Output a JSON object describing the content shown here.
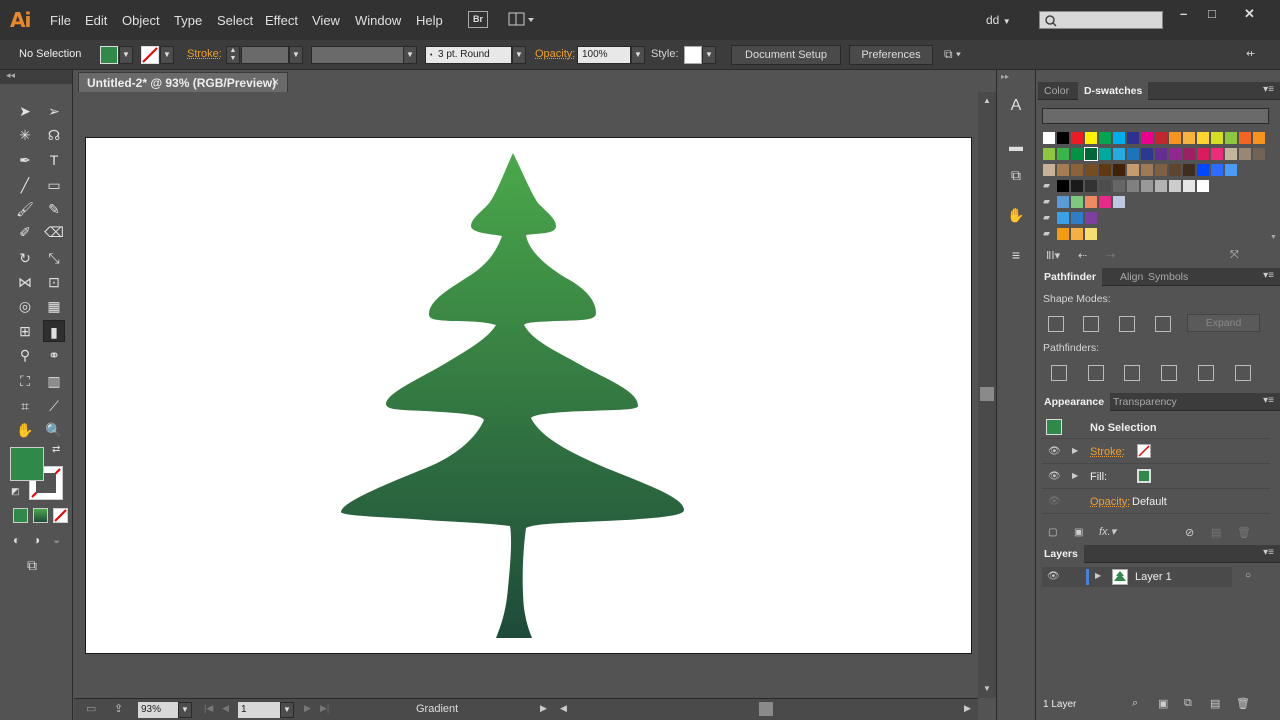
{
  "app": {
    "logo": "Ai"
  },
  "menu": [
    "File",
    "Edit",
    "Object",
    "Type",
    "Select",
    "Effect",
    "View",
    "Window",
    "Help"
  ],
  "bridge_label": "Br",
  "workspace_label": "dd",
  "window_controls": [
    "–",
    "□",
    "✕"
  ],
  "control": {
    "selection": "No Selection",
    "stroke_label": "Stroke:",
    "brush": "3 pt. Round",
    "opacity_label": "Opacity:",
    "opacity_value": "100%",
    "style_label": "Style:",
    "doc_setup": "Document Setup",
    "preferences": "Preferences"
  },
  "document": {
    "tab_title": "Untitled-2* @ 93% (RGB/Preview)",
    "zoom": "93%",
    "artboard_num": "1",
    "status_text": "Gradient"
  },
  "colors": {
    "tree_top": "#4aa84a",
    "tree_bottom": "#1e4a3a",
    "fill_swatch": "#2f8a4a"
  },
  "swatches_panel": {
    "tabs": [
      "Color",
      "D-swatches"
    ],
    "row1": [
      "#ffffff",
      "#000000",
      "#ed1c24",
      "#fff200",
      "#00a651",
      "#00aeef",
      "#2e3192",
      "#ec008c",
      "#c1272d",
      "#f7941d",
      "#f8b33d",
      "#fdd432",
      "#d7df23",
      "#8dc63f",
      "#f26522",
      "#f7941d"
    ],
    "row2": [
      "#8dc63f",
      "#39b54a",
      "#009444",
      "#006838",
      "#00a99d",
      "#27aae1",
      "#1c75bc",
      "#2b3990",
      "#662d91",
      "#92278f",
      "#9e1f63",
      "#da1c5c",
      "#ee2a7b",
      "#c2b59b",
      "#998675",
      "#736357"
    ],
    "row3": [
      "#c7b299",
      "#a67c52",
      "#8c6239",
      "#754c24",
      "#603913",
      "#42210b",
      "#c69c6d",
      "#9e7a56",
      "#7d6044",
      "#5e4530",
      "#3f2d1f",
      "#0047ff",
      "#2d6cfe",
      "#4a9af8"
    ],
    "row4": [
      "#000000",
      "#1a1a1a",
      "#333333",
      "#4d4d4d",
      "#666666",
      "#808080",
      "#999999",
      "#b3b3b3",
      "#cccccc",
      "#e6e6e6",
      "#ffffff"
    ],
    "row5": [
      "#5b9bd5",
      "#7fc97f",
      "#ef8a62",
      "#e7298a",
      "#bdc9e1"
    ],
    "row6": [
      "#3ba0e6",
      "#2d7ec7",
      "#7e3fa0"
    ],
    "row7": [
      "#f39c12",
      "#f5b041",
      "#f7dc6f"
    ]
  },
  "pathfinder": {
    "tabs": [
      "Pathfinder",
      "Align",
      "Symbols"
    ],
    "shape_modes_label": "Shape Modes:",
    "expand": "Expand",
    "pathfinders_label": "Pathfinders:"
  },
  "appearance": {
    "tabs": [
      "Appearance",
      "Transparency"
    ],
    "title": "No Selection",
    "stroke": "Stroke:",
    "fill": "Fill:",
    "opacity": "Opacity:",
    "opacity_value": "Default",
    "fx": "fx."
  },
  "layers": {
    "tab": "Layers",
    "layer_name": "Layer 1",
    "count": "1 Layer"
  }
}
